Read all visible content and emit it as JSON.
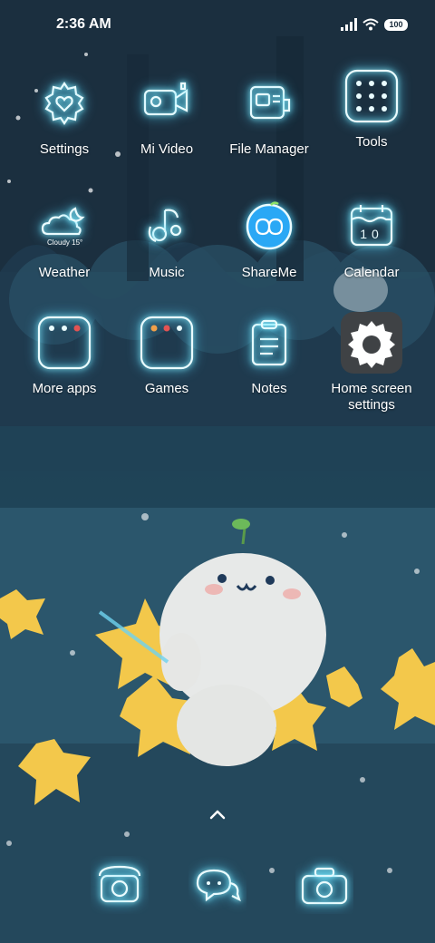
{
  "status_bar": {
    "time": "2:36 AM",
    "battery": "100"
  },
  "home": {
    "apps": [
      {
        "label": "Settings",
        "icon": "settings-gear-heart-icon"
      },
      {
        "label": "Mi Video",
        "icon": "video-camera-icon"
      },
      {
        "label": "File Manager",
        "icon": "file-manager-icon"
      },
      {
        "label": "Tools",
        "icon": "tools-folder-icon"
      },
      {
        "label": "Weather",
        "icon": "weather-cloud-moon-icon"
      },
      {
        "label": "Music",
        "icon": "music-note-icon"
      },
      {
        "label": "ShareMe",
        "icon": "shareme-icon"
      },
      {
        "label": "Calendar",
        "icon": "calendar-icon"
      },
      {
        "label": "More apps",
        "icon": "more-apps-folder-icon"
      },
      {
        "label": "Games",
        "icon": "games-folder-icon"
      },
      {
        "label": "Notes",
        "icon": "notes-clipboard-icon"
      },
      {
        "label": "Home screen settings",
        "icon": "gear-icon"
      }
    ],
    "weather_caption": "Cloudy 15°",
    "calendar_day": "10"
  },
  "dock": {
    "items": [
      {
        "icon": "phone-icon"
      },
      {
        "icon": "messages-icon"
      },
      {
        "icon": "camera-icon"
      }
    ]
  },
  "colors": {
    "neon": "#eafcff",
    "glow": "#54d8ff",
    "shareme": "#2aa8f5",
    "gear_tile": "#3f4245"
  }
}
